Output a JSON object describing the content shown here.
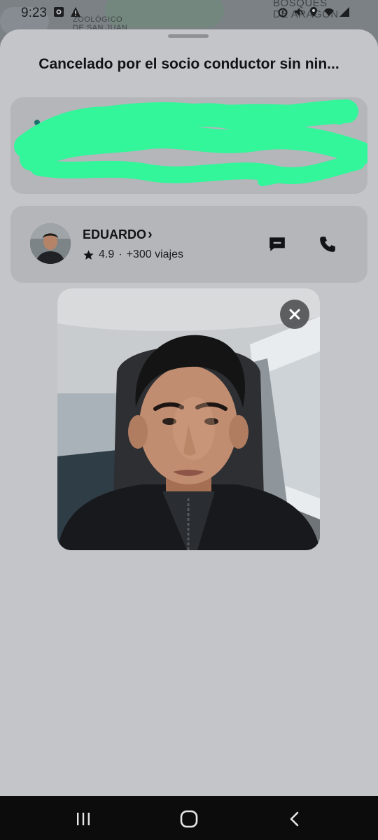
{
  "status_bar": {
    "time": "9:23",
    "left_icons": [
      "photo-icon",
      "warning-icon"
    ],
    "right_icons": [
      "alarm-icon",
      "mute-icon",
      "location-icon",
      "wifi-icon",
      "signal-icon"
    ]
  },
  "map": {
    "label_left_line1": "ZOOLÓGICO",
    "label_left_line2": "DE SAN JUAN",
    "label_right_line1": "BOSQUES",
    "label_right_line2": "DE ARAGÓN"
  },
  "sheet": {
    "title": "Cancelado por el socio conductor sin nin...",
    "address_redacted": true,
    "redaction_color": "#33f59a"
  },
  "driver": {
    "name": "EDUARDO",
    "chevron": "›",
    "rating": "4.9",
    "separator": "·",
    "trips": "+300 viajes",
    "icons": [
      "star-icon",
      "message-icon",
      "phone-icon"
    ]
  },
  "photo": {
    "subject": "driver-photo",
    "close_icon": "close-icon"
  },
  "nav": {
    "icons": [
      "recent-apps-icon",
      "home-icon",
      "back-icon"
    ]
  },
  "colors": {
    "sheet": "#c4c5c9",
    "card": "#b4b6ba",
    "nav": "#0c0c0c"
  }
}
